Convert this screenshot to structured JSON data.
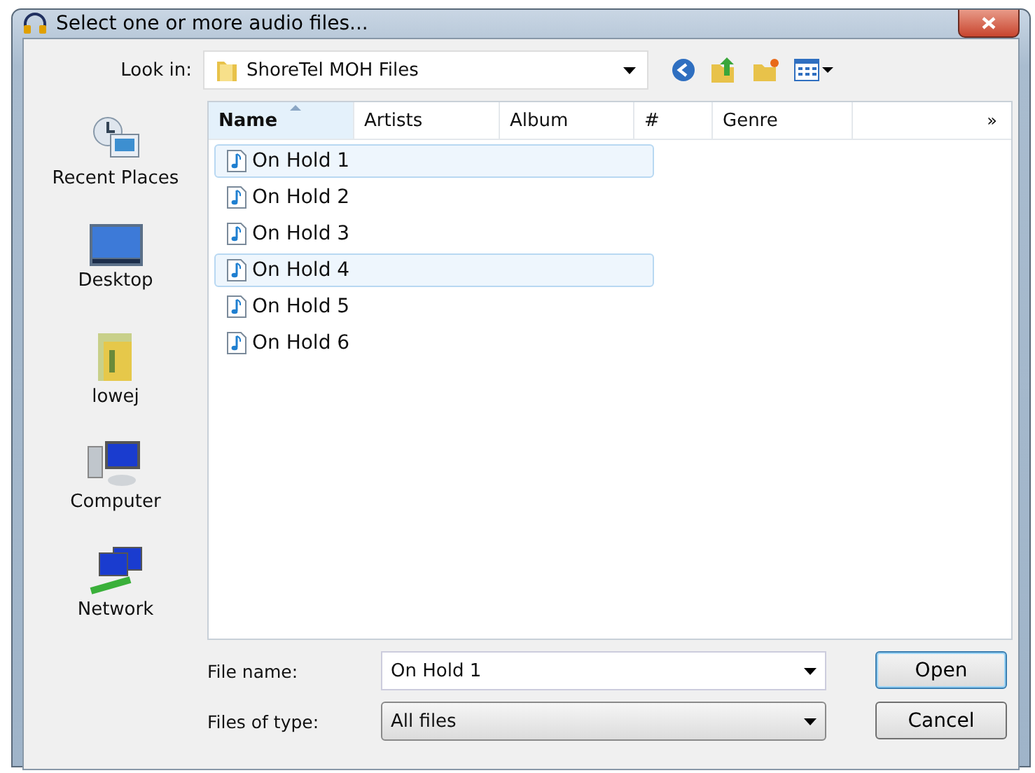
{
  "window": {
    "title": "Select one or more audio files..."
  },
  "look_in": {
    "label": "Look in:",
    "value": "ShoreTel MOH Files"
  },
  "places": [
    {
      "label": "Recent Places",
      "kind": "recent"
    },
    {
      "label": "Desktop",
      "kind": "desktop"
    },
    {
      "label": "lowej",
      "kind": "user"
    },
    {
      "label": "Computer",
      "kind": "computer"
    },
    {
      "label": "Network",
      "kind": "network"
    }
  ],
  "columns": [
    {
      "label": "Name",
      "sorted": true
    },
    {
      "label": "Artists",
      "sorted": false
    },
    {
      "label": "Album",
      "sorted": false
    },
    {
      "label": "#",
      "sorted": false
    },
    {
      "label": "Genre",
      "sorted": false
    }
  ],
  "more_columns": "»",
  "files": [
    {
      "name": "On Hold 1",
      "selected": true
    },
    {
      "name": "On Hold 2",
      "selected": false
    },
    {
      "name": "On Hold 3",
      "selected": false
    },
    {
      "name": "On Hold 4",
      "selected": true
    },
    {
      "name": "On Hold 5",
      "selected": false
    },
    {
      "name": "On Hold 6",
      "selected": false
    }
  ],
  "file_name": {
    "label": "File name:",
    "value": "On Hold 1"
  },
  "file_type": {
    "label": "Files of type:",
    "value": "All files"
  },
  "buttons": [
    "Open",
    "Cancel"
  ]
}
